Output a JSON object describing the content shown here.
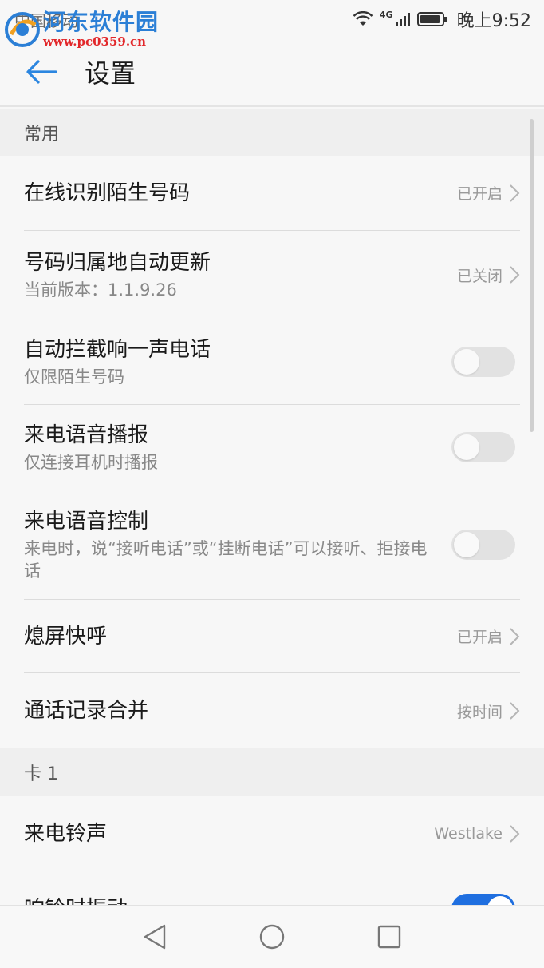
{
  "status_bar": {
    "carrier": "中国移动",
    "network": "4G",
    "time": "晚上9:52"
  },
  "watermark": {
    "title": "河东软件园",
    "url": "www.pc0359.cn"
  },
  "app_bar": {
    "back_icon": "arrow-left-icon",
    "title": "设置"
  },
  "sections": [
    {
      "header": "常用",
      "items": [
        {
          "title": "在线识别陌生号码",
          "value": "已开启",
          "type": "link"
        },
        {
          "title": "号码归属地自动更新",
          "subtitle": "当前版本：1.1.9.26",
          "value": "已关闭",
          "type": "link"
        },
        {
          "title": "自动拦截响一声电话",
          "subtitle": "仅限陌生号码",
          "type": "toggle",
          "on": false
        },
        {
          "title": "来电语音播报",
          "subtitle": "仅连接耳机时播报",
          "type": "toggle",
          "on": false
        },
        {
          "title": "来电语音控制",
          "subtitle": "来电时，说“接听电话”或“挂断电话”可以接听、拒接电话",
          "type": "toggle",
          "on": false
        },
        {
          "title": "熄屏快呼",
          "value": "已开启",
          "type": "link"
        },
        {
          "title": "通话记录合并",
          "value": "按时间",
          "type": "link"
        }
      ]
    },
    {
      "header": "卡 1",
      "items": [
        {
          "title": "来电铃声",
          "value": "Westlake",
          "type": "link"
        },
        {
          "title": "响铃时振动",
          "type": "toggle",
          "on": true
        }
      ]
    }
  ],
  "nav_bar": {
    "back": "triangle-back-icon",
    "home": "circle-home-icon",
    "recents": "square-recents-icon"
  },
  "colors": {
    "accent": "#1f6fe0",
    "back_arrow": "#2b86e0",
    "background": "#f7f7f7",
    "section_bg": "#efefef"
  }
}
